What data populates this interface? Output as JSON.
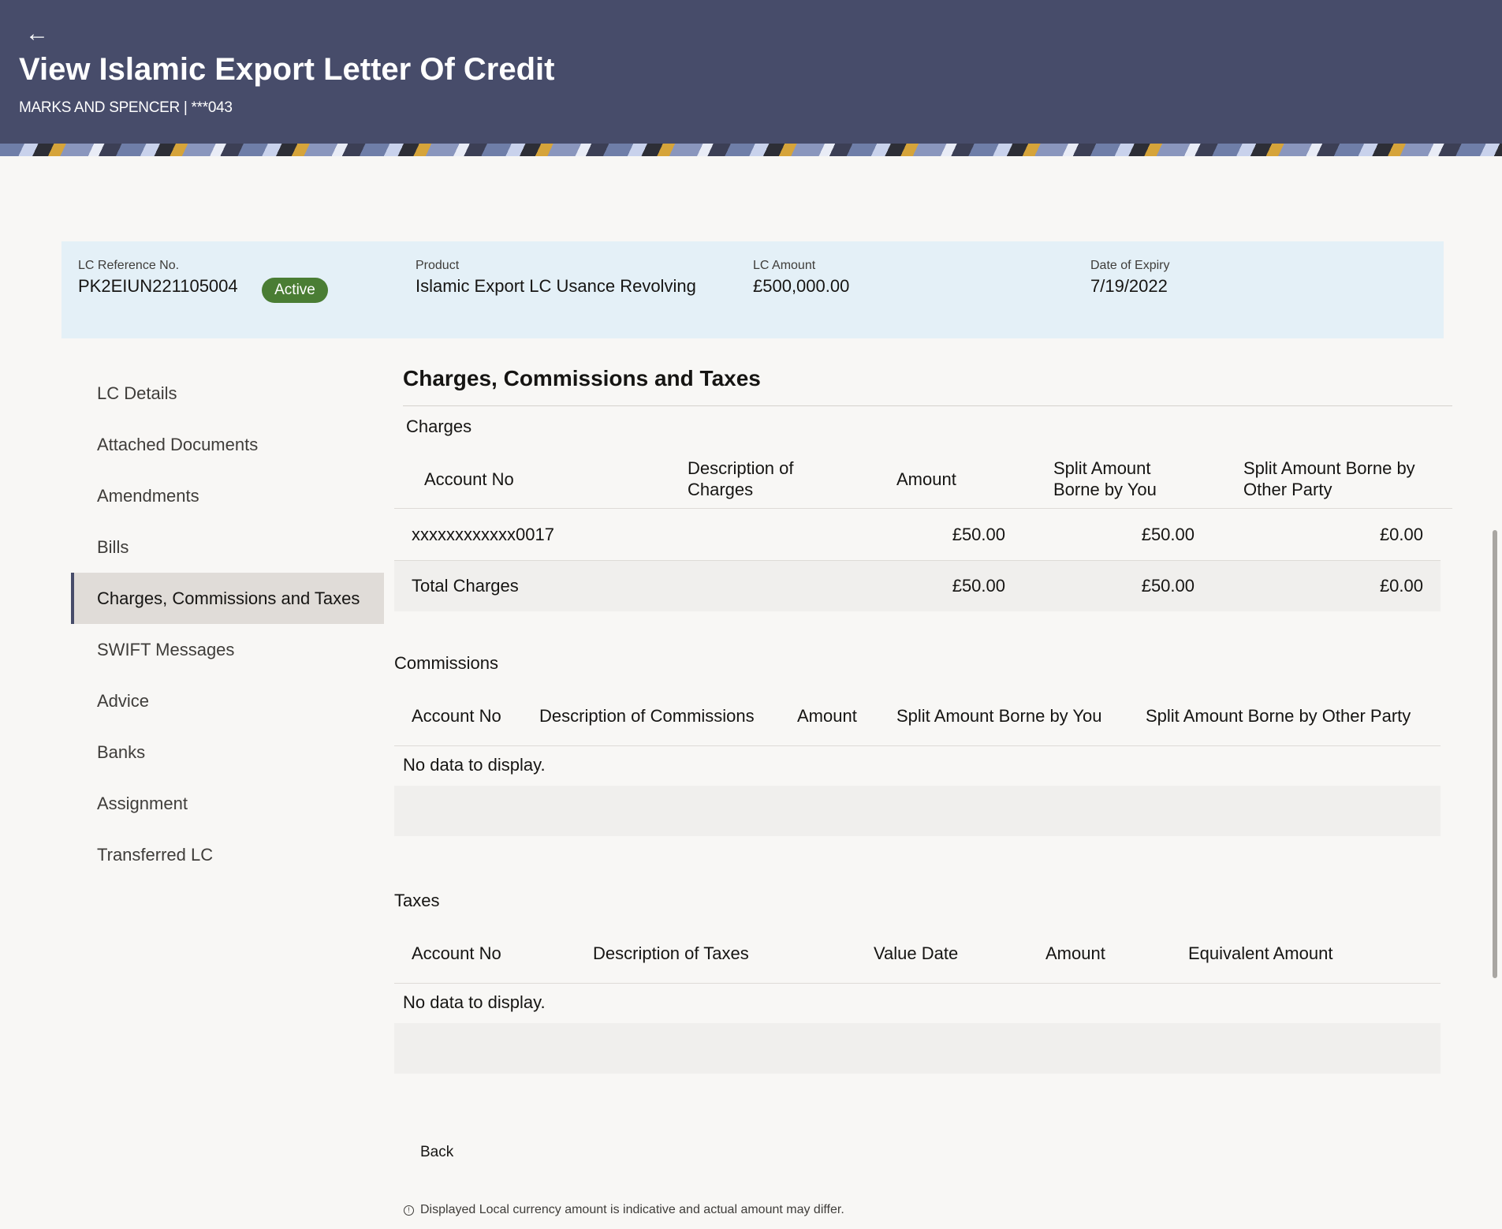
{
  "header": {
    "title": "View Islamic Export Letter Of Credit",
    "subtitle": "MARKS AND SPENCER | ***043",
    "back_icon": "←"
  },
  "summary": {
    "lc_ref_label": "LC Reference No.",
    "lc_ref_value": "PK2EIUN221105004",
    "status": "Active",
    "product_label": "Product",
    "product_value": "Islamic Export LC Usance Revolving",
    "amount_label": "LC Amount",
    "amount_value": "£500,000.00",
    "expiry_label": "Date of Expiry",
    "expiry_value": "7/19/2022",
    "status_color": "#4a7d34",
    "background_color": "#e4f0f7"
  },
  "nav": {
    "items": [
      {
        "label": "LC Details"
      },
      {
        "label": "Attached Documents"
      },
      {
        "label": "Amendments"
      },
      {
        "label": "Bills"
      },
      {
        "label": "Charges, Commissions and Taxes"
      },
      {
        "label": "SWIFT Messages"
      },
      {
        "label": "Advice"
      },
      {
        "label": "Banks"
      },
      {
        "label": "Assignment"
      },
      {
        "label": "Transferred LC"
      }
    ],
    "active_label": "Charges, Commissions and Taxes"
  },
  "content": {
    "title": "Charges, Commissions and Taxes",
    "charges": {
      "heading": "Charges",
      "columns": [
        "Account No",
        "Description of Charges",
        "Amount",
        "Split Amount Borne by You",
        "Split Amount Borne by Other Party"
      ],
      "rows": [
        {
          "account": "xxxxxxxxxxxx0017",
          "description": "",
          "amount": "£50.00",
          "by_you": "£50.00",
          "by_other": "£0.00"
        }
      ],
      "total": {
        "label": "Total Charges",
        "amount": "£50.00",
        "by_you": "£50.00",
        "by_other": "£0.00"
      }
    },
    "commissions": {
      "heading": "Commissions",
      "columns": [
        "Account No",
        "Description of Commissions",
        "Amount",
        "Split Amount Borne by You",
        "Split Amount Borne by Other Party"
      ],
      "empty": "No data to display."
    },
    "taxes": {
      "heading": "Taxes",
      "columns": [
        "Account No",
        "Description of Taxes",
        "Value Date",
        "Amount",
        "Equivalent Amount"
      ],
      "empty": "No data to display."
    }
  },
  "footer": {
    "back_label": "Back",
    "note": "Displayed Local currency amount is indicative and actual amount may differ.",
    "info_icon": "!"
  },
  "colors": {
    "header_bg": "#474c6a",
    "page_bg": "#f8f7f5"
  }
}
